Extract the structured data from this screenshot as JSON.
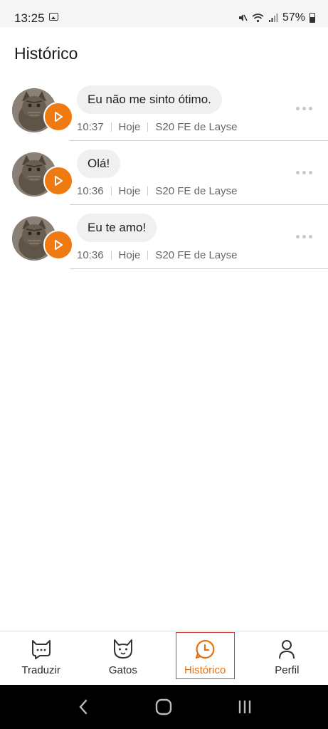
{
  "status_bar": {
    "time": "13:25",
    "battery": "57%",
    "icons": [
      "image-icon",
      "mute-icon",
      "wifi-icon",
      "signal-icon",
      "battery-icon"
    ]
  },
  "page_title": "Histórico",
  "history": [
    {
      "message": "Eu não me sinto ótimo.",
      "time": "10:37",
      "day": "Hoje",
      "device": "S20 FE de Layse"
    },
    {
      "message": "Olá!",
      "time": "10:36",
      "day": "Hoje",
      "device": "S20 FE de Layse"
    },
    {
      "message": "Eu te amo!",
      "time": "10:36",
      "day": "Hoje",
      "device": "S20 FE de Layse"
    }
  ],
  "bottom_nav": {
    "items": [
      {
        "label": "Traduzir",
        "icon": "cat-chat-icon"
      },
      {
        "label": "Gatos",
        "icon": "cat-face-icon"
      },
      {
        "label": "Histórico",
        "icon": "clock-icon",
        "active": true
      },
      {
        "label": "Perfil",
        "icon": "person-icon"
      }
    ],
    "active_color": "#e9700e"
  },
  "colors": {
    "accent": "#f07a12",
    "bubble": "#f0f0f0",
    "highlight_box": "#d63a3a"
  }
}
